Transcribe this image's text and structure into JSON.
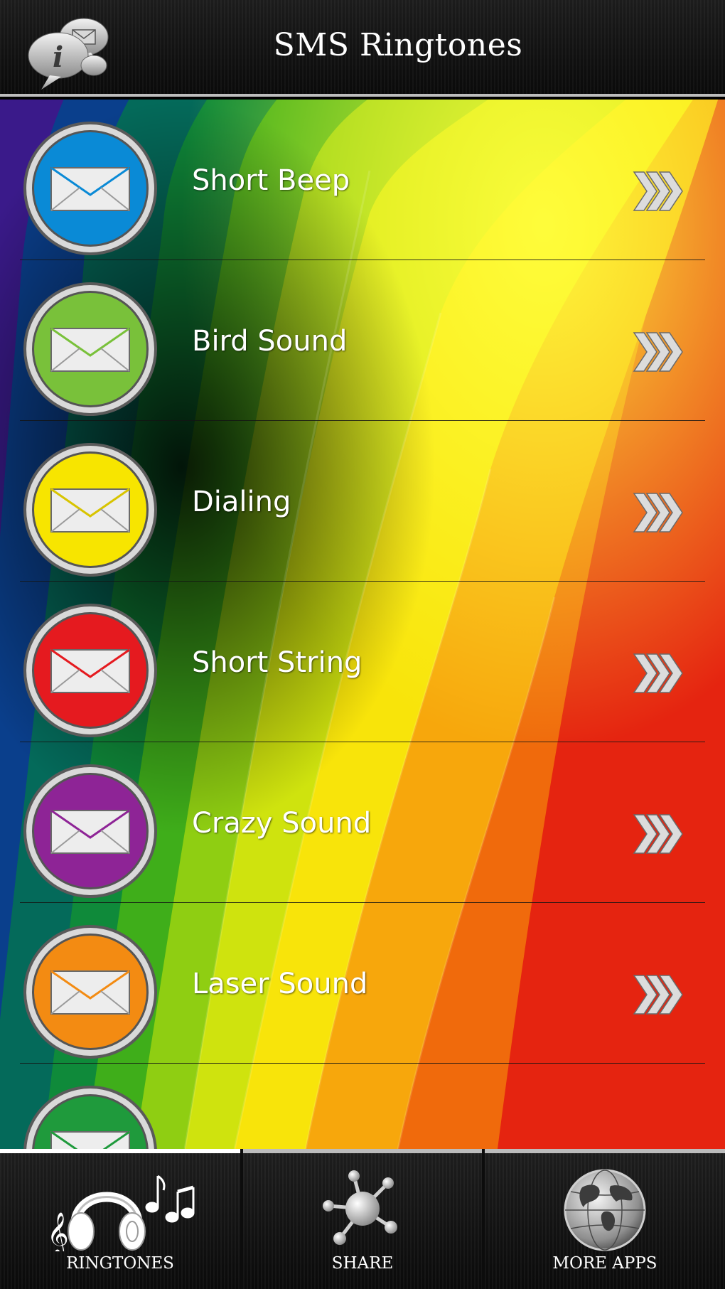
{
  "header": {
    "title": "SMS Ringtones",
    "logo_icon": "info-message-bubbles-icon"
  },
  "ringtones": [
    {
      "label": "Short Beep",
      "color": "#0a8ad6",
      "icon": "envelope-icon"
    },
    {
      "label": "Bird Sound",
      "color": "#79c13a",
      "icon": "envelope-icon"
    },
    {
      "label": "Dialing",
      "color": "#f7e500",
      "icon": "envelope-icon"
    },
    {
      "label": "Short String",
      "color": "#e51a1f",
      "icon": "envelope-icon"
    },
    {
      "label": "Crazy Sound",
      "color": "#8e2496",
      "icon": "envelope-icon"
    },
    {
      "label": "Laser Sound",
      "color": "#f38b12",
      "icon": "envelope-icon"
    },
    {
      "label": "",
      "color": "#1f9a3c",
      "icon": "envelope-icon"
    }
  ],
  "item_chevron_icon": "triple-chevron-right-icon",
  "tabs": [
    {
      "label": "RINGTONES",
      "icon": "headphones-music-icon",
      "active": true
    },
    {
      "label": "SHARE",
      "icon": "share-network-icon",
      "active": false
    },
    {
      "label": "MORE APPS",
      "icon": "globe-icon",
      "active": false
    }
  ]
}
